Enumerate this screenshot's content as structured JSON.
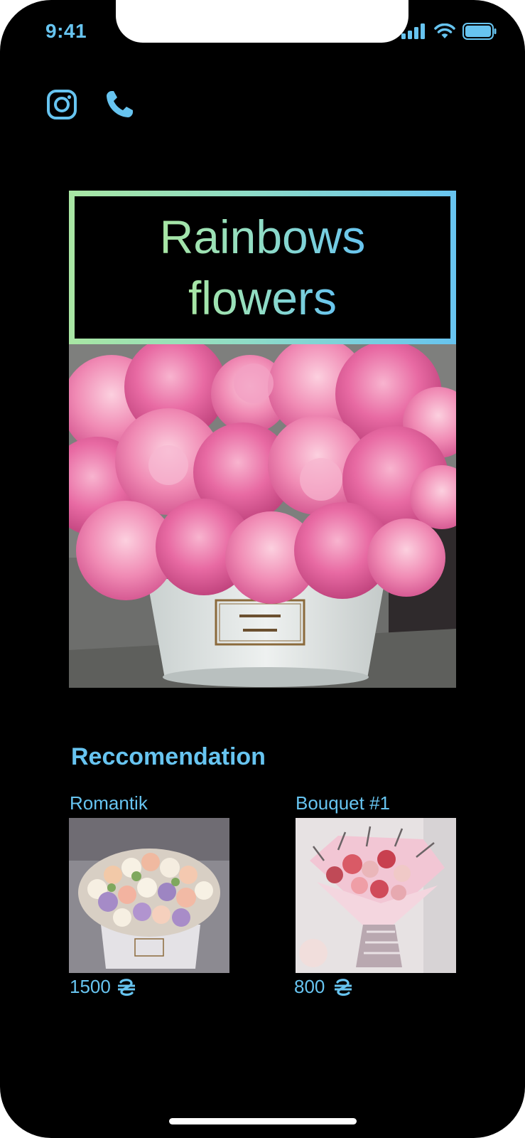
{
  "status_bar": {
    "time": "9:41",
    "icons": [
      "signal-icon",
      "wifi-icon",
      "battery-icon"
    ]
  },
  "header": {
    "icons": [
      "instagram-icon",
      "phone-icon"
    ]
  },
  "hero": {
    "title_line1": "Rainbows",
    "title_line2": "flowers",
    "image": "pink-peonies-box-photo"
  },
  "recommendations": {
    "title": "Reccomendation",
    "items": [
      {
        "name": "Romantik",
        "price": "1500",
        "currency_icon": "hryvnia-icon",
        "image": "flower-box-photo"
      },
      {
        "name": "Bouquet #1",
        "price": "800",
        "currency_icon": "hryvnia-icon",
        "image": "dried-bouquet-photo"
      }
    ]
  },
  "colors": {
    "background": "#000000",
    "accent": "#67c4f0",
    "gradient_start": "#a8e6a3",
    "gradient_end": "#67c4f0"
  }
}
